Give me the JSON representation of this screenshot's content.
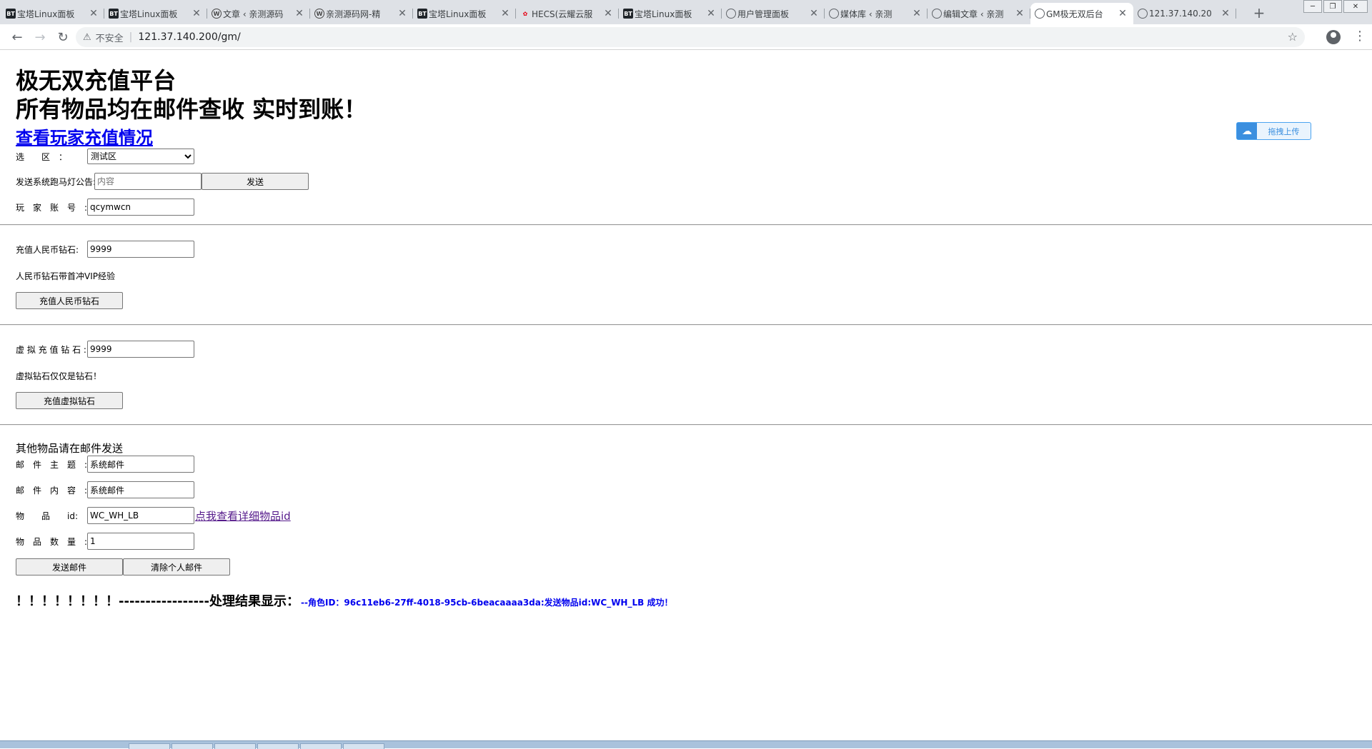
{
  "browser": {
    "tabs": [
      {
        "label": "宝塔Linux面板",
        "icon": "bt-icon"
      },
      {
        "label": "宝塔Linux面板",
        "icon": "bt-icon"
      },
      {
        "label": "文章 ‹ 亲测源码",
        "icon": "wordpress-icon"
      },
      {
        "label": "亲测源码网-精",
        "icon": "wordpress-icon"
      },
      {
        "label": "宝塔Linux面板",
        "icon": "bt-icon"
      },
      {
        "label": "HECS(云耀云服",
        "icon": "huawei-icon"
      },
      {
        "label": "宝塔Linux面板",
        "icon": "bt-icon"
      },
      {
        "label": "用户管理面板",
        "icon": "globe-icon"
      },
      {
        "label": "媒体库 ‹ 亲测",
        "icon": "globe-icon"
      },
      {
        "label": "编辑文章 ‹ 亲测",
        "icon": "globe-icon"
      },
      {
        "label": "GM极无双后台",
        "icon": "globe-icon"
      },
      {
        "label": "121.37.140.20",
        "icon": "globe-icon"
      }
    ],
    "active_tab_index": 10,
    "address": {
      "security_label": "不安全",
      "url": "121.37.140.200/gm/"
    }
  },
  "page": {
    "title_line1": "极无双充值平台",
    "title_line2": "所有物品均在邮件查收 实时到账！",
    "recharge_link": "查看玩家充值情况",
    "zone": {
      "label": "选　　区　：",
      "selected": "测试区"
    },
    "marquee": {
      "label": "发送系统跑马灯公告:",
      "placeholder": "内容",
      "button": "发送"
    },
    "account": {
      "label": "玩　家　账　号　:",
      "value": "qcymwcn"
    },
    "rmb": {
      "label": "充值人民币钻石:",
      "value": "9999",
      "note": "人民币钻石带首冲VIP经验",
      "button": "充值人民币钻石"
    },
    "virtual": {
      "label": "虚 拟 充 值 钻 石 :",
      "value": "9999",
      "note": "虚拟钻石仅仅是钻石！",
      "button": "充值虚拟钻石"
    },
    "mail": {
      "section_title": "其他物品请在邮件发送",
      "subject": {
        "label": "邮　件　主　题　:",
        "value": "系统邮件"
      },
      "content": {
        "label": "邮　件　内　容　:",
        "value": "系统邮件"
      },
      "item": {
        "label": "物　　品　　id:",
        "value": "WC_WH_LB",
        "link": "点我查看详细物品id"
      },
      "quantity": {
        "label": "物　品　数　量　:",
        "value": "1"
      },
      "send_button": "发送邮件",
      "clear_button": "清除个人邮件"
    },
    "result": {
      "prefix": "！！！！！！！！-----------------处理结果显示：",
      "message": "--角色ID：96c11eb6-27ff-4018-95cb-6beacaaaa3da:发送物品id:WC_WH_LB 成功！"
    },
    "upload_widget": {
      "label": "拖拽上传",
      "icon": "cloud-icon"
    }
  }
}
